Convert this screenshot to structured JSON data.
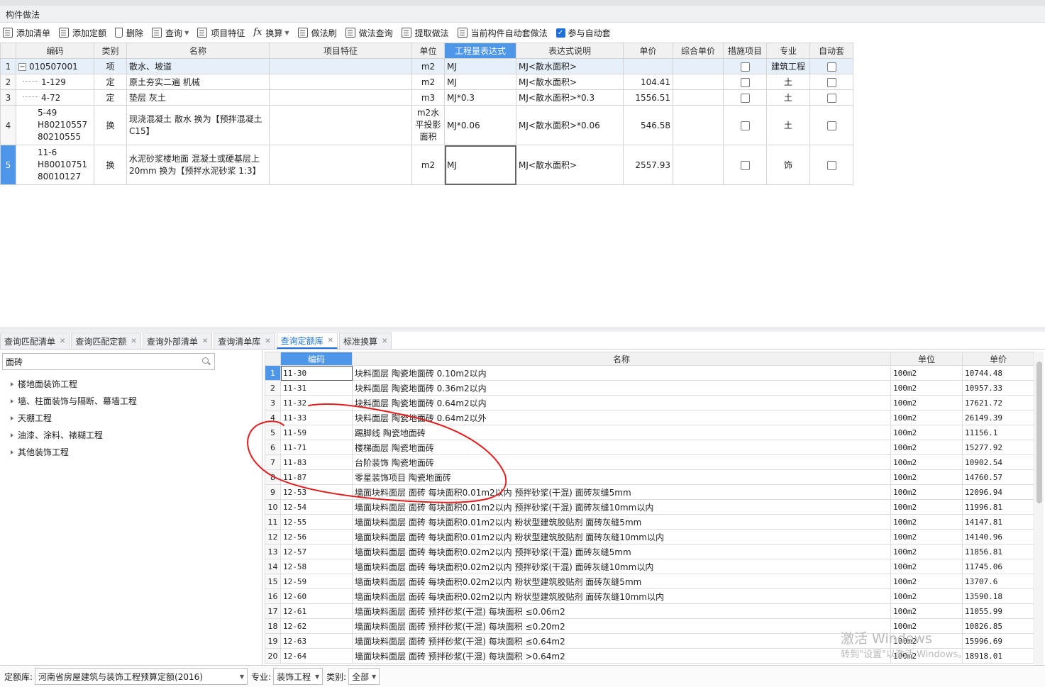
{
  "title": "构件做法",
  "toolbar": {
    "add_list": "添加清单",
    "add_quota": "添加定额",
    "delete": "删除",
    "query": "查询",
    "item_feature": "项目特征",
    "convert": "换算",
    "method_brush": "做法刷",
    "method_query": "做法查询",
    "extract_method": "提取做法",
    "auto_apply_current": "当前构件自动套做法",
    "join_auto_apply": "参与自动套"
  },
  "top_grid": {
    "headers": [
      "编码",
      "类别",
      "名称",
      "项目特征",
      "单位",
      "工程量表达式",
      "表达式说明",
      "单价",
      "综合单价",
      "措施项目",
      "专业",
      "自动套"
    ],
    "rows": [
      {
        "n": "1",
        "code": "010507001",
        "type": "项",
        "name": "散水、坡道",
        "unit": "m2",
        "expr": "MJ",
        "desc": "MJ<散水面积>",
        "price": "",
        "spec": "建筑工程"
      },
      {
        "n": "2",
        "code": "1-129",
        "type": "定",
        "name": "原土夯实二遍 机械",
        "unit": "m2",
        "expr": "MJ",
        "desc": "MJ<散水面积>",
        "price": "104.41",
        "spec": "土"
      },
      {
        "n": "3",
        "code": "4-72",
        "type": "定",
        "name": "垫层 灰土",
        "unit": "m3",
        "expr": "MJ*0.3",
        "desc": "MJ<散水面积>*0.3",
        "price": "1556.51",
        "spec": "土"
      },
      {
        "n": "4",
        "code": "5-49 H80210557 80210555",
        "type": "换",
        "name": "现浇混凝土 散水  换为【预拌混凝土 C15】",
        "unit": "m2水平投影面积",
        "expr": "MJ*0.06",
        "desc": "MJ<散水面积>*0.06",
        "price": "546.58",
        "spec": "土"
      },
      {
        "n": "5",
        "code": "11-6 H80010751 80010127",
        "type": "换",
        "name": "水泥砂浆楼地面 混凝土或硬基层上20mm  换为【预拌水泥砂浆 1:3】",
        "unit": "m2",
        "expr": "MJ",
        "desc": "MJ<散水面积>",
        "price": "2557.93",
        "spec": "饰"
      }
    ]
  },
  "tabs": [
    {
      "label": "查询匹配清单"
    },
    {
      "label": "查询匹配定额"
    },
    {
      "label": "查询外部清单"
    },
    {
      "label": "查询清单库"
    },
    {
      "label": "查询定额库"
    },
    {
      "label": "标准换算"
    }
  ],
  "search": {
    "value": "面砖"
  },
  "tree": [
    {
      "label": "楼地面装饰工程"
    },
    {
      "label": "墙、柱面装饰与隔断、幕墙工程"
    },
    {
      "label": "天棚工程"
    },
    {
      "label": "油漆、涂料、裱糊工程"
    },
    {
      "label": "其他装饰工程"
    }
  ],
  "quota_grid": {
    "headers": [
      "编码",
      "名称",
      "单位",
      "单价"
    ],
    "rows": [
      {
        "n": "1",
        "code": "11-30",
        "name": "块料面层 陶瓷地面砖 0.10m2以内",
        "unit": "100m2",
        "price": "10744.48"
      },
      {
        "n": "2",
        "code": "11-31",
        "name": "块料面层 陶瓷地面砖 0.36m2以内",
        "unit": "100m2",
        "price": "10957.33"
      },
      {
        "n": "3",
        "code": "11-32",
        "name": "块料面层 陶瓷地面砖 0.64m2以内",
        "unit": "100m2",
        "price": "17621.72"
      },
      {
        "n": "4",
        "code": "11-33",
        "name": "块料面层 陶瓷地面砖 0.64m2以外",
        "unit": "100m2",
        "price": "26149.39"
      },
      {
        "n": "5",
        "code": "11-59",
        "name": "踢脚线 陶瓷地面砖",
        "unit": "100m2",
        "price": "11156.1"
      },
      {
        "n": "6",
        "code": "11-71",
        "name": "楼梯面层 陶瓷地面砖",
        "unit": "100m2",
        "price": "15277.92"
      },
      {
        "n": "7",
        "code": "11-83",
        "name": "台阶装饰 陶瓷地面砖",
        "unit": "100m2",
        "price": "10902.54"
      },
      {
        "n": "8",
        "code": "11-87",
        "name": "零星装饰项目 陶瓷地面砖",
        "unit": "100m2",
        "price": "14760.57"
      },
      {
        "n": "9",
        "code": "12-53",
        "name": "墙面块料面层 面砖 每块面积0.01m2以内 预拌砂浆(干混) 面砖灰缝5mm",
        "unit": "100m2",
        "price": "12096.94"
      },
      {
        "n": "10",
        "code": "12-54",
        "name": "墙面块料面层 面砖 每块面积0.01m2以内 预拌砂浆(干混) 面砖灰缝10mm以内",
        "unit": "100m2",
        "price": "11996.81"
      },
      {
        "n": "11",
        "code": "12-55",
        "name": "墙面块料面层 面砖 每块面积0.01m2以内 粉状型建筑胶贴剂 面砖灰缝5mm",
        "unit": "100m2",
        "price": "14147.81"
      },
      {
        "n": "12",
        "code": "12-56",
        "name": "墙面块料面层 面砖 每块面积0.01m2以内 粉状型建筑胶贴剂 面砖灰缝10mm以内",
        "unit": "100m2",
        "price": "14140.96"
      },
      {
        "n": "13",
        "code": "12-57",
        "name": "墙面块料面层 面砖 每块面积0.02m2以内 预拌砂浆(干混) 面砖灰缝5mm",
        "unit": "100m2",
        "price": "11856.81"
      },
      {
        "n": "14",
        "code": "12-58",
        "name": "墙面块料面层 面砖 每块面积0.02m2以内 预拌砂浆(干混) 面砖灰缝10mm以内",
        "unit": "100m2",
        "price": "11745.06"
      },
      {
        "n": "15",
        "code": "12-59",
        "name": "墙面块料面层 面砖 每块面积0.02m2以内 粉状型建筑胶贴剂 面砖灰缝5mm",
        "unit": "100m2",
        "price": "13707.6"
      },
      {
        "n": "16",
        "code": "12-60",
        "name": "墙面块料面层 面砖 每块面积0.02m2以内 粉状型建筑胶贴剂 面砖灰缝10mm以内",
        "unit": "100m2",
        "price": "13590.18"
      },
      {
        "n": "17",
        "code": "12-61",
        "name": "墙面块料面层 面砖 预拌砂浆(干混) 每块面积 ≤0.06m2",
        "unit": "100m2",
        "price": "11055.99"
      },
      {
        "n": "18",
        "code": "12-62",
        "name": "墙面块料面层 面砖 预拌砂浆(干混) 每块面积 ≤0.20m2",
        "unit": "100m2",
        "price": "10826.85"
      },
      {
        "n": "19",
        "code": "12-63",
        "name": "墙面块料面层 面砖 预拌砂浆(干混) 每块面积 ≤0.64m2",
        "unit": "100m2",
        "price": "15996.69"
      },
      {
        "n": "20",
        "code": "12-64",
        "name": "墙面块料面层 面砖 预拌砂浆(干混) 每块面积 >0.64m2",
        "unit": "100m2",
        "price": "18918.01"
      }
    ]
  },
  "status": {
    "library_label": "定额库:",
    "library_value": "河南省房屋建筑与装饰工程预算定额(2016)",
    "specialty_label": "专业:",
    "specialty_value": "装饰工程",
    "category_label": "类别:",
    "category_value": "全部"
  },
  "watermark": {
    "line1": "激活 Windows",
    "line2": "转到\"设置\"以激活 Windows。"
  },
  "colors": {
    "accent": "#4d96e8",
    "annotation": "#e02020"
  }
}
